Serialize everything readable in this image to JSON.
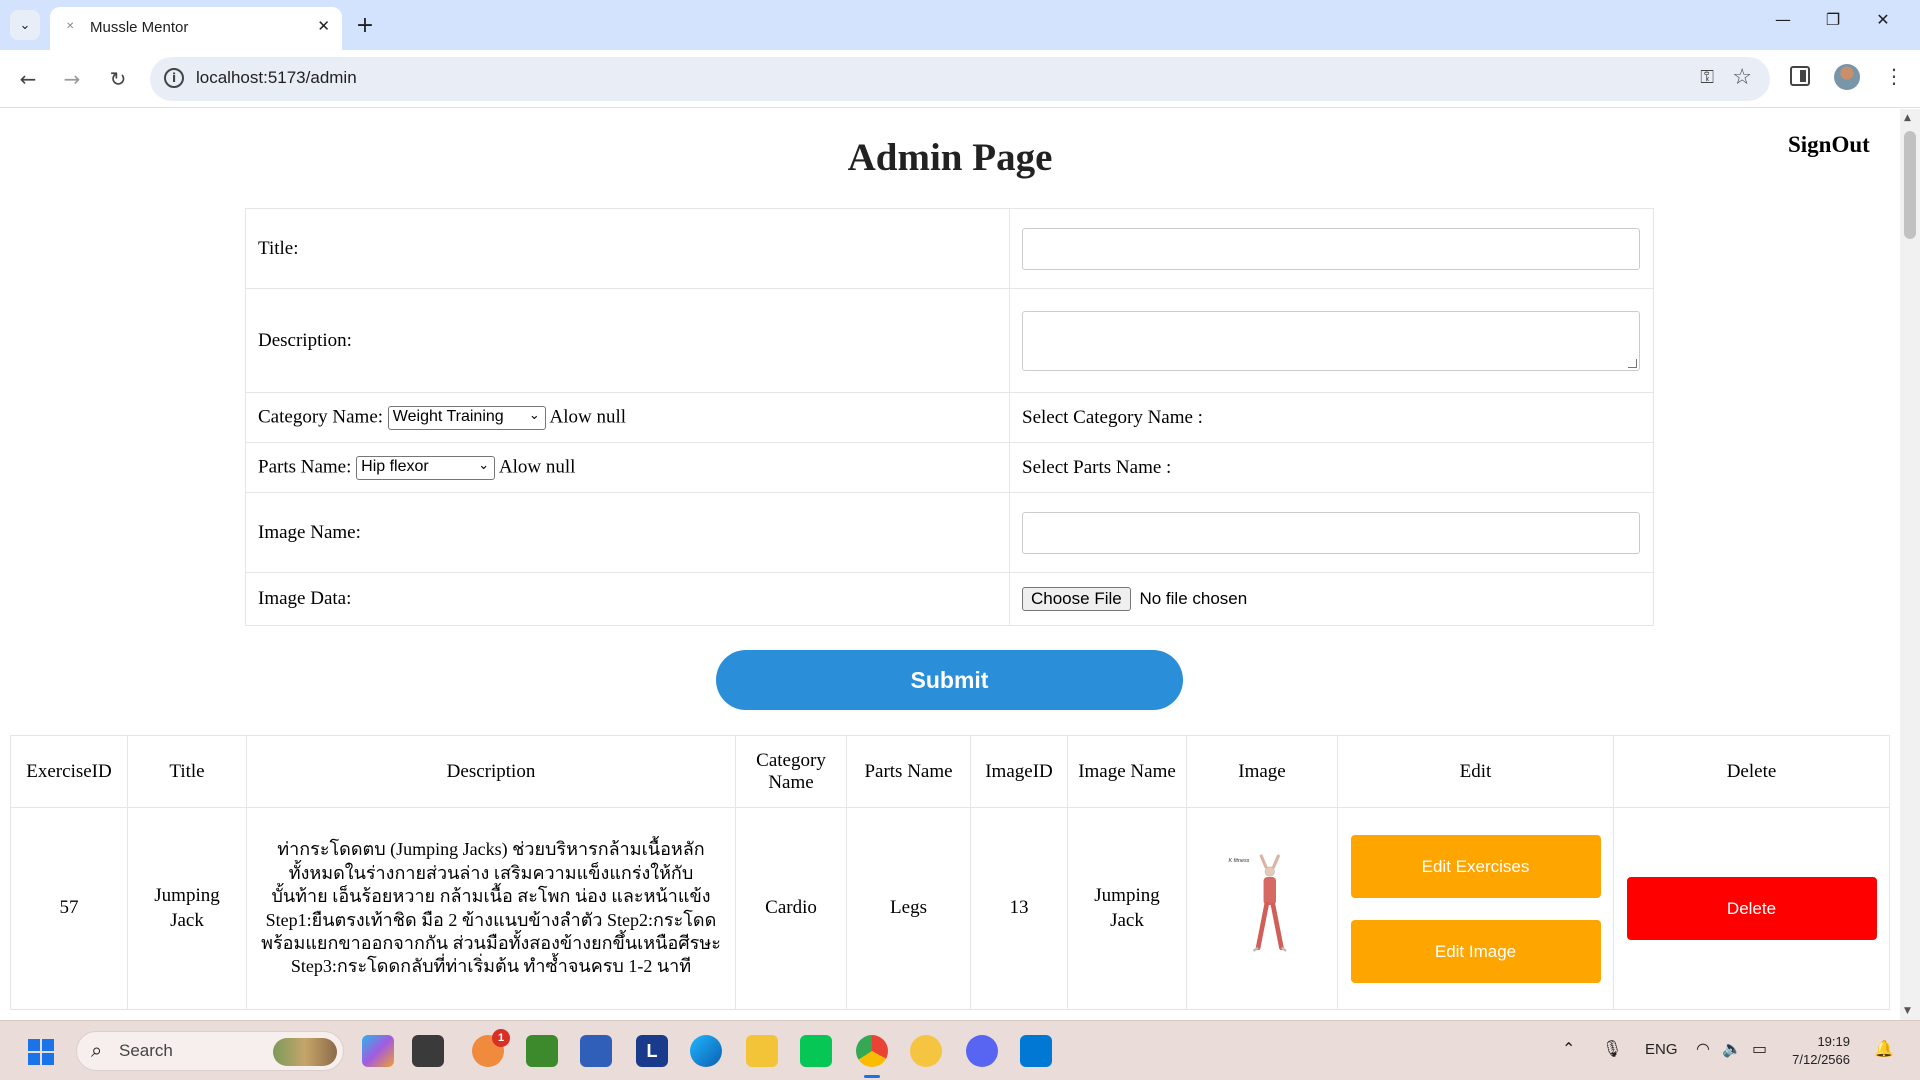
{
  "browser": {
    "tab_title": "Mussle Mentor",
    "url": "localhost:5173/admin"
  },
  "page": {
    "title": "Admin Page",
    "signout": "SignOut"
  },
  "form": {
    "title_label": "Title:",
    "description_label": "Description:",
    "category_label": "Category Name:",
    "category_selected": "Weight Training",
    "category_allow_null": "Alow null",
    "category_select_text": "Select Category Name :",
    "parts_label": "Parts Name:",
    "parts_selected": "Hip flexor",
    "parts_allow_null": "Alow null",
    "parts_select_text": "Select Parts Name :",
    "image_name_label": "Image Name:",
    "image_data_label": "Image Data:",
    "choose_file": "Choose File",
    "no_file": "No file chosen",
    "submit": "Submit"
  },
  "table": {
    "headers": {
      "exercise_id": "ExerciseID",
      "title": "Title",
      "description": "Description",
      "category_name": "Category Name",
      "parts_name": "Parts Name",
      "image_id": "ImageID",
      "image_name": "Image Name",
      "image": "Image",
      "edit": "Edit",
      "delete": "Delete"
    },
    "rows": [
      {
        "exercise_id": "57",
        "title": "Jumping Jack",
        "description": "ท่ากระโดดตบ (Jumping Jacks) ช่วยบริหารกล้ามเนื้อหลักทั้งหมดในร่างกายส่วนล่าง เสริมความแข็งแกร่งให้กับบั้นท้าย เอ็นร้อยหวาย กล้ามเนื้อ สะโพก น่อง และหน้าแข้ง Step1:ยืนตรงเท้าชิด มือ 2 ข้างแนบข้างลำตัว Step2:กระโดดพร้อมแยกขาออกจากกัน ส่วนมือทั้งสองข้างยกขึ้นเหนือศีรษะ Step3:กระโดดกลับที่ท่าเริ่มต้น ทำซ้ำจนครบ 1-2 นาที",
        "category_name": "Cardio",
        "parts_name": "Legs",
        "image_id": "13",
        "image_name": "Jumping Jack",
        "edit_exercises": "Edit Exercises",
        "edit_image": "Edit Image",
        "delete": "Delete"
      }
    ]
  },
  "taskbar": {
    "search": "Search",
    "lang": "ENG",
    "time": "19:19",
    "date": "7/12/2566",
    "badge": "1"
  },
  "colors": {
    "submit": "#2a8fd8",
    "edit": "#ffa500",
    "delete": "#ff0000"
  }
}
